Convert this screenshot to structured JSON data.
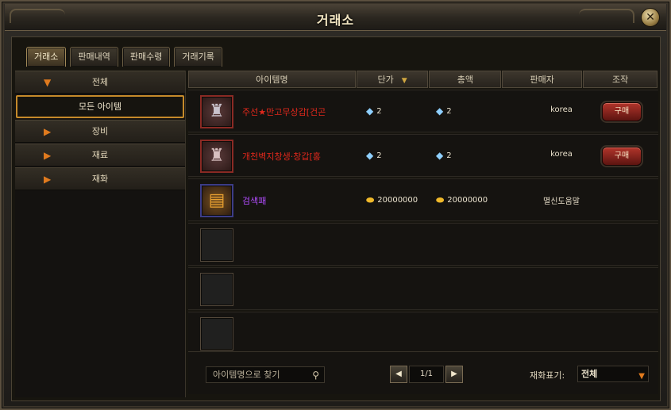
{
  "window": {
    "title": "거래소",
    "close_glyph": "✕"
  },
  "tabs": [
    {
      "label": "거래소",
      "active": true
    },
    {
      "label": "판매내역",
      "active": false
    },
    {
      "label": "판매수령",
      "active": false
    },
    {
      "label": "거래기록",
      "active": false
    }
  ],
  "sidebar": {
    "items": [
      {
        "label": "전체",
        "icon": "chevron-down-icon"
      },
      {
        "label": "모든 아이템",
        "selected": true
      },
      {
        "label": "장비",
        "icon": "chevron-right-icon"
      },
      {
        "label": "재료",
        "icon": "chevron-right-icon"
      },
      {
        "label": "재화",
        "icon": "chevron-right-icon"
      }
    ]
  },
  "table": {
    "headers": [
      "아이템명",
      "단가",
      "총액",
      "판매자",
      "조작"
    ],
    "sort_column": "단가",
    "rows": [
      {
        "name": "주선★만고무상갑[건곤",
        "name_color": "#e0281c",
        "unit_price": "2",
        "total": "2",
        "currency": "diamond",
        "seller": "korea",
        "action": "구매",
        "icon": "armor-icon"
      },
      {
        "name": "개천벽지창생·창갑[홍",
        "name_color": "#e0281c",
        "unit_price": "2",
        "total": "2",
        "currency": "diamond",
        "seller": "korea",
        "action": "구매",
        "icon": "armor-icon"
      },
      {
        "name": "검색패",
        "name_color": "#b24cff",
        "unit_price": "20000000",
        "total": "20000000",
        "currency": "gold",
        "seller": "멸신도움말",
        "action": "",
        "icon": "scroll-icon"
      }
    ]
  },
  "footer": {
    "search_placeholder": "아이템명으로 찾기",
    "page_indicator": "1/1",
    "currency_label": "재화표기:",
    "currency_value": "전체"
  }
}
